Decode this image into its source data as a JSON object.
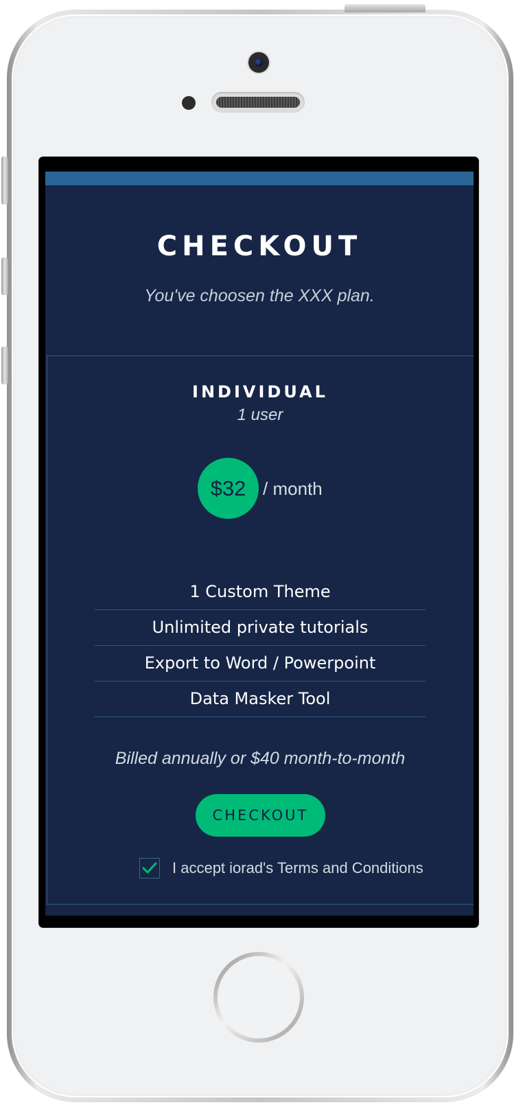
{
  "screen": {
    "title": "CHECKOUT",
    "subtitle": "You've choosen the XXX plan."
  },
  "plan": {
    "name": "INDIVIDUAL",
    "users": "1 user",
    "price": "$32",
    "period": "/ month",
    "features": [
      "1 Custom Theme",
      "Unlimited private tutorials",
      "Export to Word / Powerpoint",
      "Data Masker Tool"
    ],
    "billing_note": "Billed annually or $40 month-to-month"
  },
  "actions": {
    "checkout_label": "CHECKOUT",
    "terms_label": "I accept iorad's Terms and Conditions",
    "terms_checked": true
  },
  "icons": {
    "check": "check-icon"
  },
  "colors": {
    "background": "#172646",
    "accent": "#00bb77",
    "top_bar": "#2b6597",
    "divider": "#2c5a8a"
  }
}
